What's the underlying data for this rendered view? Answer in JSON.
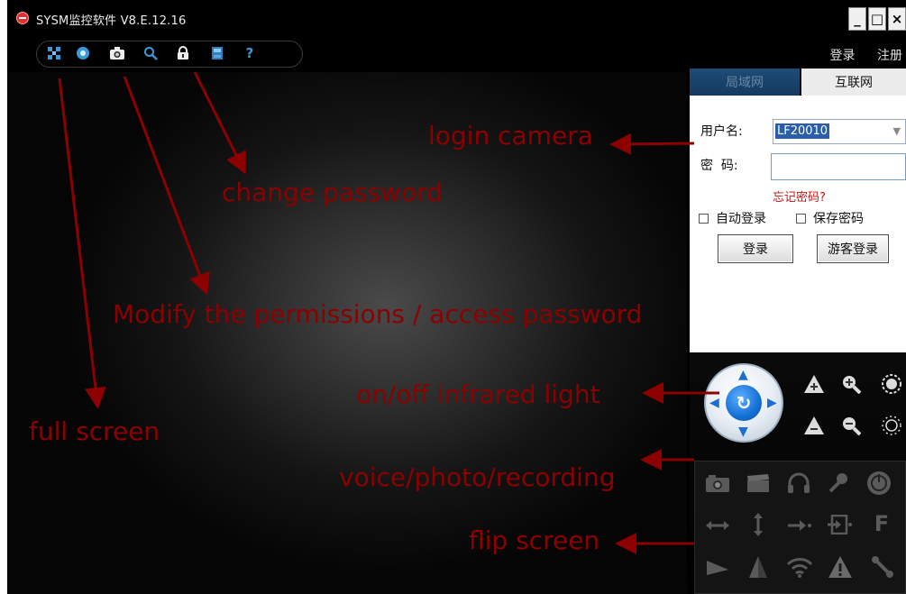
{
  "window": {
    "title": "SYSM监控软件  V8.E.12.16",
    "controls": [
      "_",
      "□",
      "×"
    ]
  },
  "toolbar": {
    "icons": [
      "fullscreen-icon",
      "record-icon",
      "camera-icon",
      "search-icon",
      "lock-icon",
      "save-icon",
      "help-icon"
    ],
    "login_link": "登录",
    "register_link": "注册"
  },
  "annotations": {
    "login_camera": "login camera",
    "change_password": "change password",
    "modify_permissions": "Modify the permissions / access password",
    "infrared": "on/off infrared light",
    "full_screen": "full screen",
    "voice_photo": "voice/photo/recording",
    "flip_screen": "flip screen"
  },
  "panel": {
    "tab_lan": "局域网",
    "tab_internet": "互联网",
    "username_label": "用户名:",
    "username_value": "LF20010",
    "password_label": "密  码:",
    "password_value": "",
    "forgot_password": "忘记密码?",
    "auto_login": "自动登录",
    "save_password": "保存密码",
    "login_button": "登录",
    "guest_button": "游客登录"
  },
  "colors": {
    "annotation_red": "#8c0000",
    "tab_active_blue": "#1e4b78",
    "forgot_red": "#c81414",
    "selection_blue": "#2b5ea8"
  }
}
